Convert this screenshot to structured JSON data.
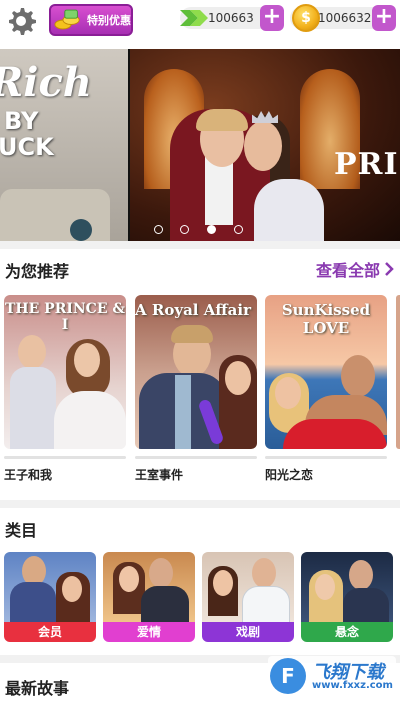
{
  "topbar": {
    "settings_icon": "gear-icon",
    "promo_label": "特别优惠",
    "tickets": "100663",
    "coins": "1006632",
    "coin_symbol": "$",
    "plus": "+"
  },
  "banner": {
    "left_title_line1": "Rich",
    "left_title_line2": "BY",
    "left_title_line3": "UCK",
    "right_title": "PRI",
    "dots": 4,
    "active_dot": 2
  },
  "recommended": {
    "title": "为您推荐",
    "see_all": "查看全部",
    "items": [
      {
        "label": "王子和我",
        "cover_text": "THE PRINCE & I"
      },
      {
        "label": "王室事件",
        "cover_text": "A Royal Affair"
      },
      {
        "label": "阳光之恋",
        "cover_text": "SunKissed LOVE"
      }
    ]
  },
  "categories": {
    "title": "类目",
    "items": [
      {
        "label": "会员",
        "color": "#e8303f"
      },
      {
        "label": "爱情",
        "color": "#e13fd0"
      },
      {
        "label": "戏剧",
        "color": "#8d35d6"
      },
      {
        "label": "悬念",
        "color": "#2fa84b"
      }
    ]
  },
  "latest": {
    "title": "最新故事"
  },
  "watermark": {
    "logo_char": "F",
    "text": "飞翔下载",
    "url": "www.fxxz.com"
  }
}
